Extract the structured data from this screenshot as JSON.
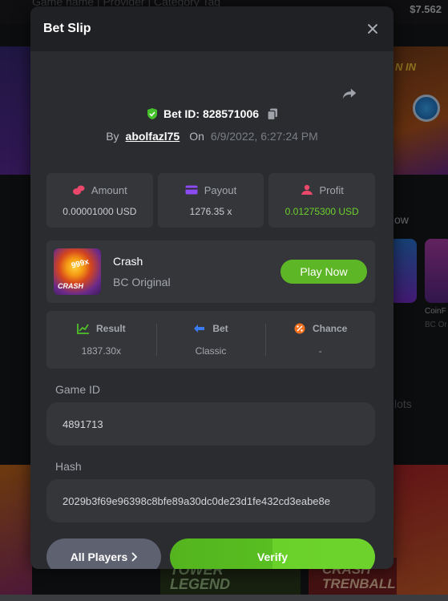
{
  "background": {
    "search_placeholder": "Game name | Provider | Category Tag",
    "balance": "$7.562",
    "win_text": "N IN",
    "row_label": "ow",
    "tile_title": "CoinF",
    "tile_sub": "BC Or",
    "slots_label": "lots",
    "tower_text": "TOWER\nLEGEND",
    "crash_text": "CRASH\nTRENBALL"
  },
  "modal": {
    "title": "Bet Slip",
    "bet_id": "Bet ID: 828571006",
    "by_label": "By",
    "username": "abolfazl75",
    "on_label": "On",
    "date": "6/9/2022, 6:27:24 PM",
    "stats": [
      {
        "label": "Amount",
        "value": "0.00001000 USD",
        "icon": "coins-icon"
      },
      {
        "label": "Payout",
        "value": "1276.35 x",
        "icon": "wallet-icon"
      },
      {
        "label": "Profit",
        "value": "0.01275300 USD",
        "icon": "profit-icon"
      }
    ],
    "game": {
      "name": "Crash",
      "provider": "BC Original",
      "thumb_multiplier": "999x",
      "thumb_label": "CRASH",
      "play_label": "Play Now"
    },
    "result": [
      {
        "label": "Result",
        "value": "1837.30x",
        "icon": "chart-icon"
      },
      {
        "label": "Bet",
        "value": "Classic",
        "icon": "bet-icon"
      },
      {
        "label": "Chance",
        "value": "-",
        "icon": "percent-icon"
      }
    ],
    "game_id_label": "Game ID",
    "game_id": "4891713",
    "hash_label": "Hash",
    "hash": "2029b3f69e96398c8bfe89a30dc0de23d1fe432cd3eabe8e",
    "all_players_label": "All Players",
    "verify_label": "Verify"
  },
  "colors": {
    "accent_green": "#5cb625",
    "profit_green": "#6ad12a",
    "modal_bg": "#2b2c30",
    "card_bg": "#35363a"
  }
}
